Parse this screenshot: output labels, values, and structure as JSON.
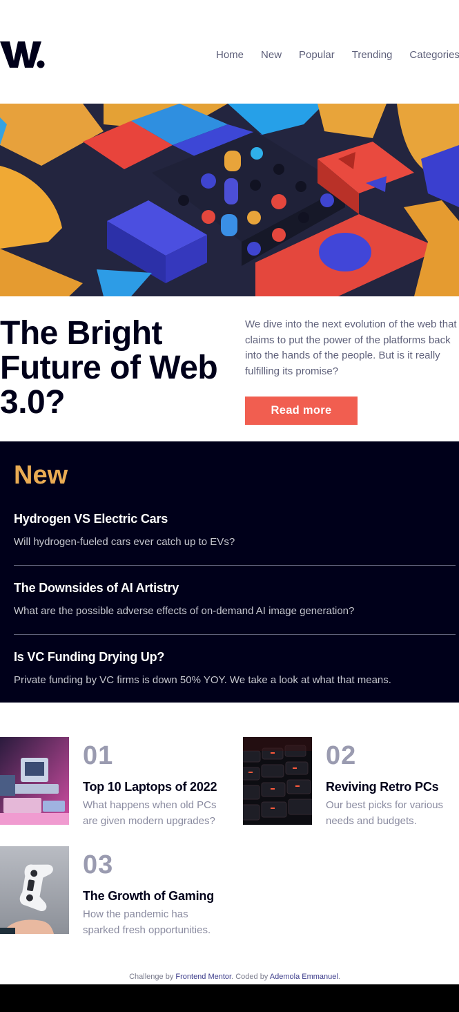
{
  "logo": {
    "letter": "W."
  },
  "nav": {
    "items": [
      {
        "label": "Home"
      },
      {
        "label": "New"
      },
      {
        "label": "Popular"
      },
      {
        "label": "Trending"
      },
      {
        "label": "Categories"
      }
    ]
  },
  "hero": {
    "title": "The Bright Future of Web 3.0?",
    "description": "We dive into the next evolution of the web that claims to put the power of the platforms back into the hands of the people. But is it really fulfilling its promise?",
    "cta_label": "Read more"
  },
  "new_section": {
    "heading": "New",
    "items": [
      {
        "title": "Hydrogen VS Electric Cars",
        "description": "Will hydrogen-fueled cars ever catch up to EVs?"
      },
      {
        "title": "The Downsides of AI Artistry",
        "description": "What are the possible adverse effects of on-demand AI image generation?"
      },
      {
        "title": "Is VC Funding Drying Up?",
        "description": "Private funding by VC firms is down 50% YOY. We take a look at what that means."
      }
    ]
  },
  "numbered": [
    {
      "number": "01",
      "title": "Top 10 Laptops of 2022",
      "description": "What happens when old PCs are given modern upgrades?"
    },
    {
      "number": "02",
      "title": "Reviving Retro PCs",
      "description": "Our best picks for various needs and budgets."
    },
    {
      "number": "03",
      "title": "The Growth of Gaming",
      "description": "How the pandemic has sparked fresh opportunities."
    }
  ],
  "footer": {
    "prefix": "Challenge by ",
    "link1": "Frontend Mentor",
    "middle": ". Coded by ",
    "link2": "Ademola Emmanuel",
    "suffix": "."
  },
  "colors": {
    "accent_red": "#f15e50",
    "accent_orange": "#e9ab53",
    "dark_blue": "#00001a",
    "grayish_blue": "#5e607a"
  }
}
